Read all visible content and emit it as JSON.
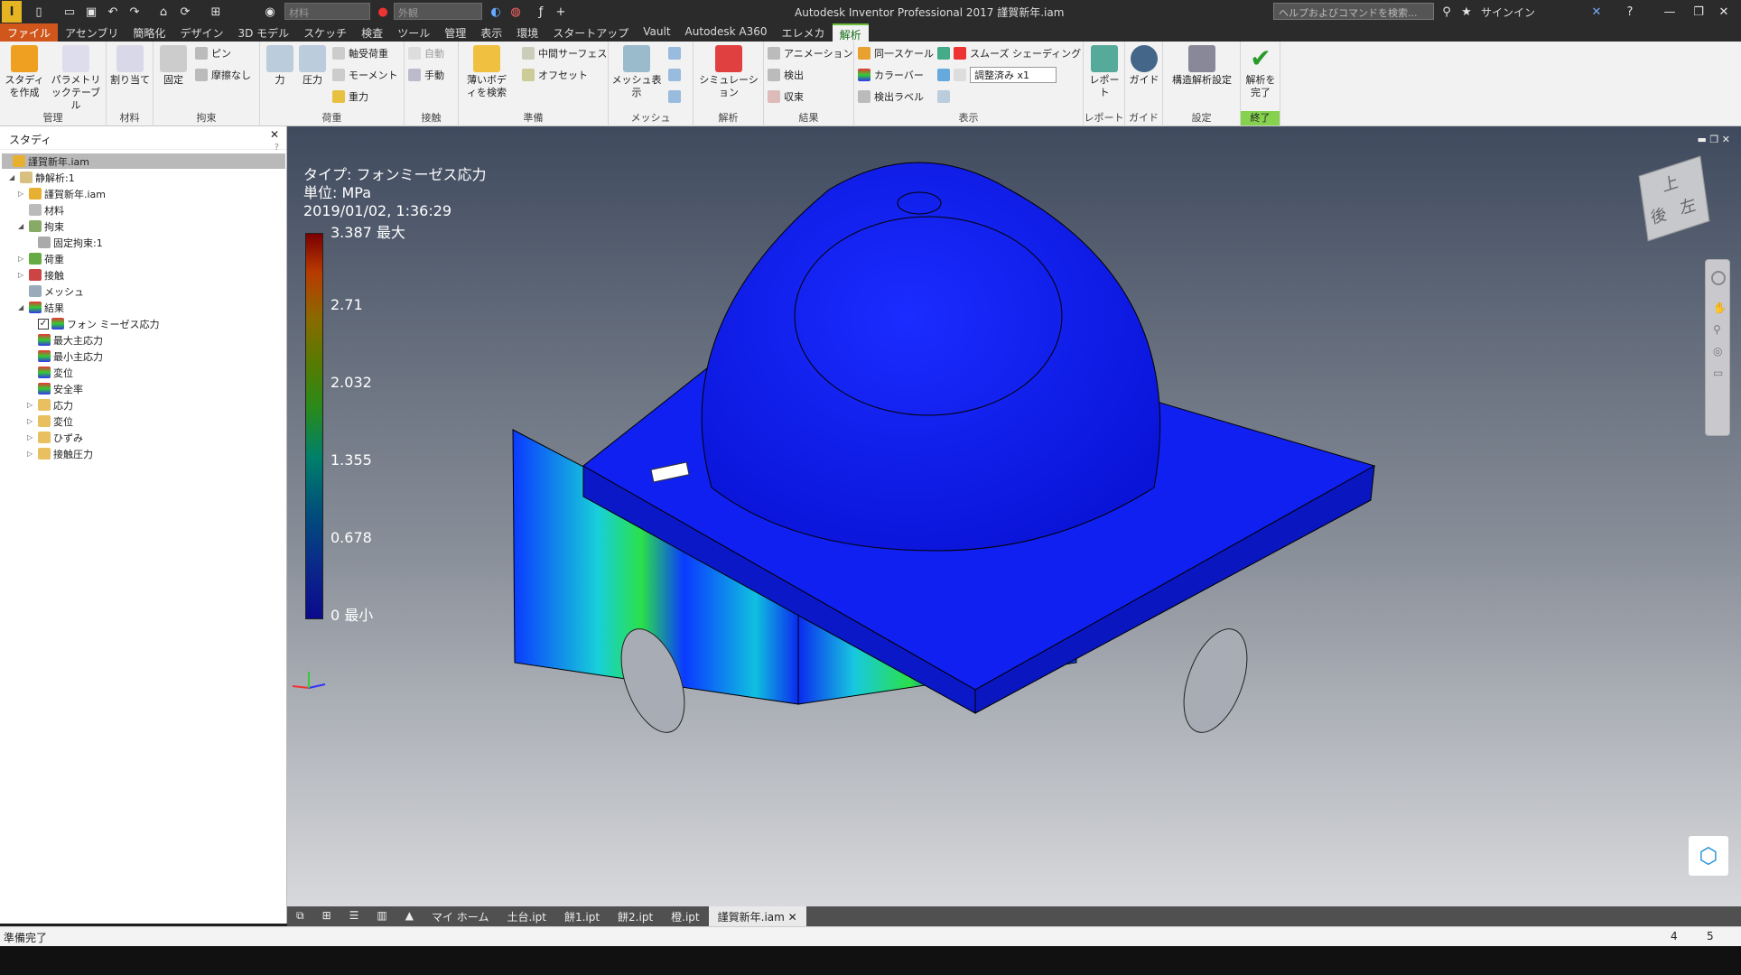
{
  "titlebar": {
    "title": "Autodesk Inventor Professional 2017    謹賀新年.iam",
    "material_placeholder": "材料",
    "appearance_placeholder": "外観",
    "help_search": "ヘルプおよびコマンドを検索...",
    "signin": "サインイン"
  },
  "menu": {
    "tabs": [
      "ファイル",
      "アセンブリ",
      "簡略化",
      "デザイン",
      "3D モデル",
      "スケッチ",
      "検査",
      "ツール",
      "管理",
      "表示",
      "環境",
      "スタートアップ",
      "Vault",
      "Autodesk A360",
      "エレメカ",
      "解析"
    ],
    "active": "解析"
  },
  "ribbon": {
    "study_create": "スタディを作成",
    "param_table": "パラメトリックテーブル",
    "assign": "割り当て",
    "fixed": "固定",
    "pin": "ピン",
    "frictionless": "摩擦なし",
    "force": "力",
    "pressure": "圧力",
    "bearing_load": "軸受荷重",
    "moment": "モーメント",
    "gravity": "重力",
    "auto": "自動",
    "manual": "手動",
    "thin_body": "薄いボディを検索",
    "midsurface": "中間サーフェス",
    "offset": "オフセット",
    "mesh_view": "メッシュ表示",
    "simulation": "シミュレーション",
    "animation": "アニメーション",
    "probe": "検出",
    "convergence": "収束",
    "same_scale": "同一スケール",
    "color_bar": "カラーバー",
    "probe_label": "検出ラベル",
    "smooth_shading": "スムーズ シェーディング",
    "adjusted": "調整済み x1",
    "report": "レポート",
    "guide": "ガイド",
    "struct_settings": "構造解析設定",
    "finish": "解析を完了",
    "panels": {
      "manage": "管理",
      "material": "材料",
      "constraint": "拘束",
      "load": "荷重",
      "contact": "接触",
      "prepare": "準備",
      "mesh": "メッシュ",
      "analysis": "解析",
      "result": "結果",
      "display": "表示",
      "report": "レポート",
      "guide": "ガイド",
      "settings": "設定",
      "exit": "終了"
    }
  },
  "browser": {
    "title": "スタディ",
    "items": [
      "謹賀新年.iam",
      "静解析:1",
      "謹賀新年.iam",
      "材料",
      "拘束",
      "固定拘束:1",
      "荷重",
      "接触",
      "メッシュ",
      "結果",
      "フォン ミーゼス応力",
      "最大主応力",
      "最小主応力",
      "変位",
      "安全率",
      "応力",
      "変位",
      "ひずみ",
      "接触圧力"
    ]
  },
  "legend": {
    "type": "タイプ: フォンミーゼス応力",
    "unit": "単位: MPa",
    "date": "2019/01/02, 1:36:29",
    "ticks": [
      "3.387 最大",
      "2.71",
      "2.032",
      "1.355",
      "0.678",
      "0 最小"
    ]
  },
  "doctabs": {
    "items": [
      "マイ ホーム",
      "土台.ipt",
      "餅1.ipt",
      "餅2.ipt",
      "橙.ipt",
      "謹賀新年.iam"
    ],
    "active": "謹賀新年.iam"
  },
  "status": {
    "text": "準備完了",
    "num1": "4",
    "num2": "5"
  },
  "viewcube": {
    "top": "上",
    "back": "後",
    "left": "左"
  }
}
